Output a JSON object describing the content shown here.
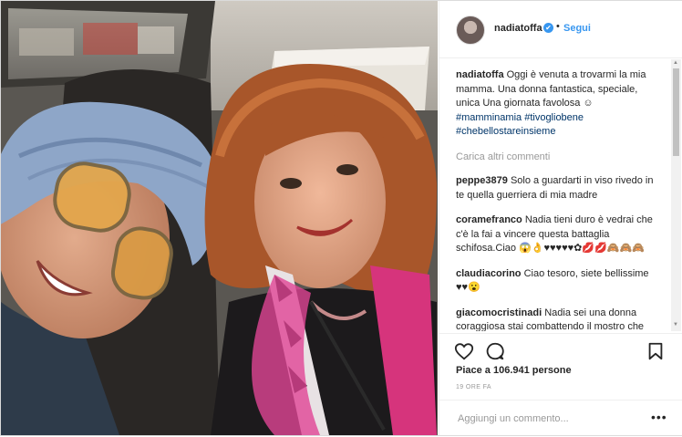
{
  "post": {
    "username": "nadiatoffa",
    "follow_label": "Segui",
    "dot": "•",
    "verified_mark": "✔",
    "caption_user": "nadiatoffa",
    "caption_text": "Oggi è venuta a trovarmi la mia mamma. Una donna fantastica, speciale, unica Una giornata favolosa ☺",
    "caption_hashtags": [
      "#mamminamia",
      "#tivogliobene",
      "#chebellostareinsieme"
    ],
    "load_more": "Carica altri commenti",
    "comments": [
      {
        "user": "peppe3879",
        "text": "Solo a guardarti in viso rivedo in te quella guerriera di mia madre"
      },
      {
        "user": "coramefranco",
        "text": "Nadia tieni duro è vedrai che c'è la fai a vincere questa battaglia schifosa.Ciao 😱👌♥♥♥♥♥✿💋💋🙈🙈🙈"
      },
      {
        "user": "claudiacorino",
        "text": "Ciao tesoro, siete bellissime ♥♥😮"
      },
      {
        "user": "giacomocristinadi",
        "text": "Nadia sei una donna coraggiosa stai combattendo il mostro che purtroppo non guarda in faccia a nessuno . Comunque sei una leonessa e hai una"
      }
    ],
    "likes": "Piace a 106.941 persone",
    "time_ago": "19 ORE FA",
    "add_comment_placeholder": "Aggiungi un commento...",
    "more_options": "•••",
    "icons": [
      "heart-icon",
      "comment-icon",
      "bookmark-icon",
      "ellipsis-icon",
      "verified-badge-icon"
    ]
  }
}
